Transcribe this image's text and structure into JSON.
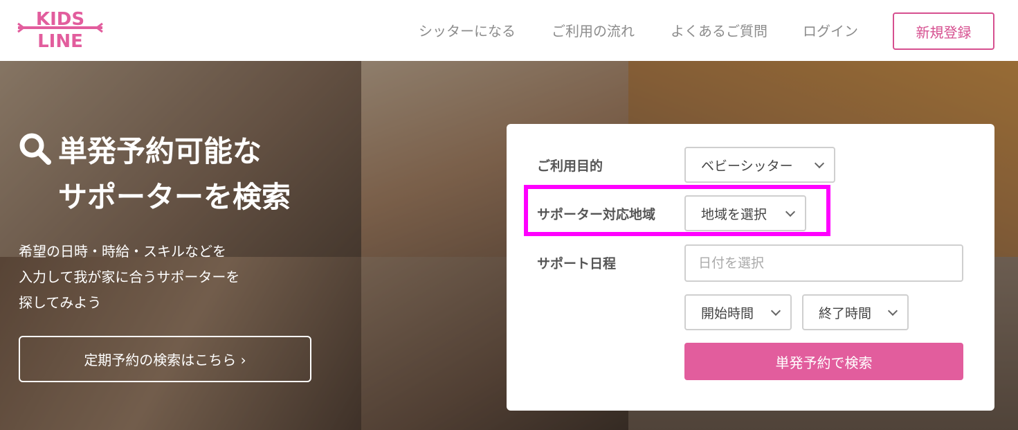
{
  "brand": {
    "logo_top": "KIDS",
    "logo_bottom": "LINE",
    "accent": "#d64f8f"
  },
  "nav": {
    "items": [
      "シッターになる",
      "ご利用の流れ",
      "よくあるご質問",
      "ログイン"
    ],
    "signup": "新規登録"
  },
  "hero": {
    "title_line1": "単発予約可能な",
    "title_line2": "サポーターを検索",
    "desc_line1": "希望の日時・時給・スキルなどを",
    "desc_line2": "入力して我が家に合うサポーターを",
    "desc_line3": "探してみよう",
    "regular_search": "定期予約の検索はこちら ›"
  },
  "form": {
    "purpose_label": "ご利用目的",
    "purpose_value": "ベビーシッター",
    "area_label": "サポーター対応地域",
    "area_value": "地域を選択",
    "schedule_label": "サポート日程",
    "date_placeholder": "日付を選択",
    "start_time": "開始時間",
    "end_time": "終了時間",
    "submit": "単発予約で検索"
  },
  "colors": {
    "primary_button": "#e25d9d",
    "highlight": "#ff00ff"
  }
}
